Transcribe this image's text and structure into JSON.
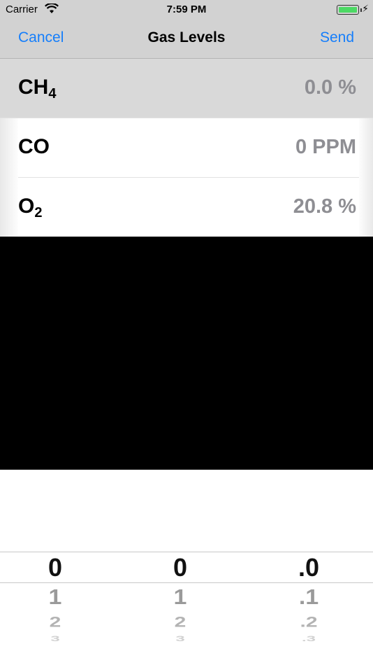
{
  "status_bar": {
    "carrier": "Carrier",
    "time": "7:59 PM",
    "wifi_icon": "wifi-icon",
    "battery_icon": "battery-charging-icon"
  },
  "nav": {
    "cancel_label": "Cancel",
    "title": "Gas Levels",
    "send_label": "Send",
    "accent_color": "#157efb"
  },
  "rows": [
    {
      "gas_main": "CH",
      "gas_sub": "4",
      "reading": "0.0 %",
      "selected": true
    },
    {
      "gas_main": "CO",
      "gas_sub": "",
      "reading": "0 PPM",
      "selected": false
    },
    {
      "gas_main": "O",
      "gas_sub": "2",
      "reading": "20.8 %",
      "selected": false
    }
  ],
  "picker": {
    "columns": [
      {
        "values": [
          "0",
          "1",
          "2",
          "3"
        ]
      },
      {
        "values": [
          "0",
          "1",
          "2",
          "3"
        ]
      },
      {
        "values": [
          ".0",
          ".1",
          ".2",
          ".3"
        ]
      }
    ]
  }
}
